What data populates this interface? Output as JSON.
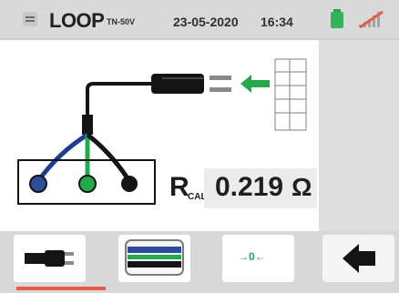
{
  "header": {
    "mode": "LOOP",
    "mode_sub": "TN-50V",
    "date": "23-05-2020",
    "time": "16:34"
  },
  "measurement": {
    "symbol": "R",
    "subscript": "CAL",
    "value": "0.219",
    "unit": "Ω"
  },
  "bottom": {
    "mid_label": "→0←"
  },
  "colors": {
    "accent": "#e85b45",
    "green": "#25a94f",
    "blue": "#2d4c9c"
  }
}
